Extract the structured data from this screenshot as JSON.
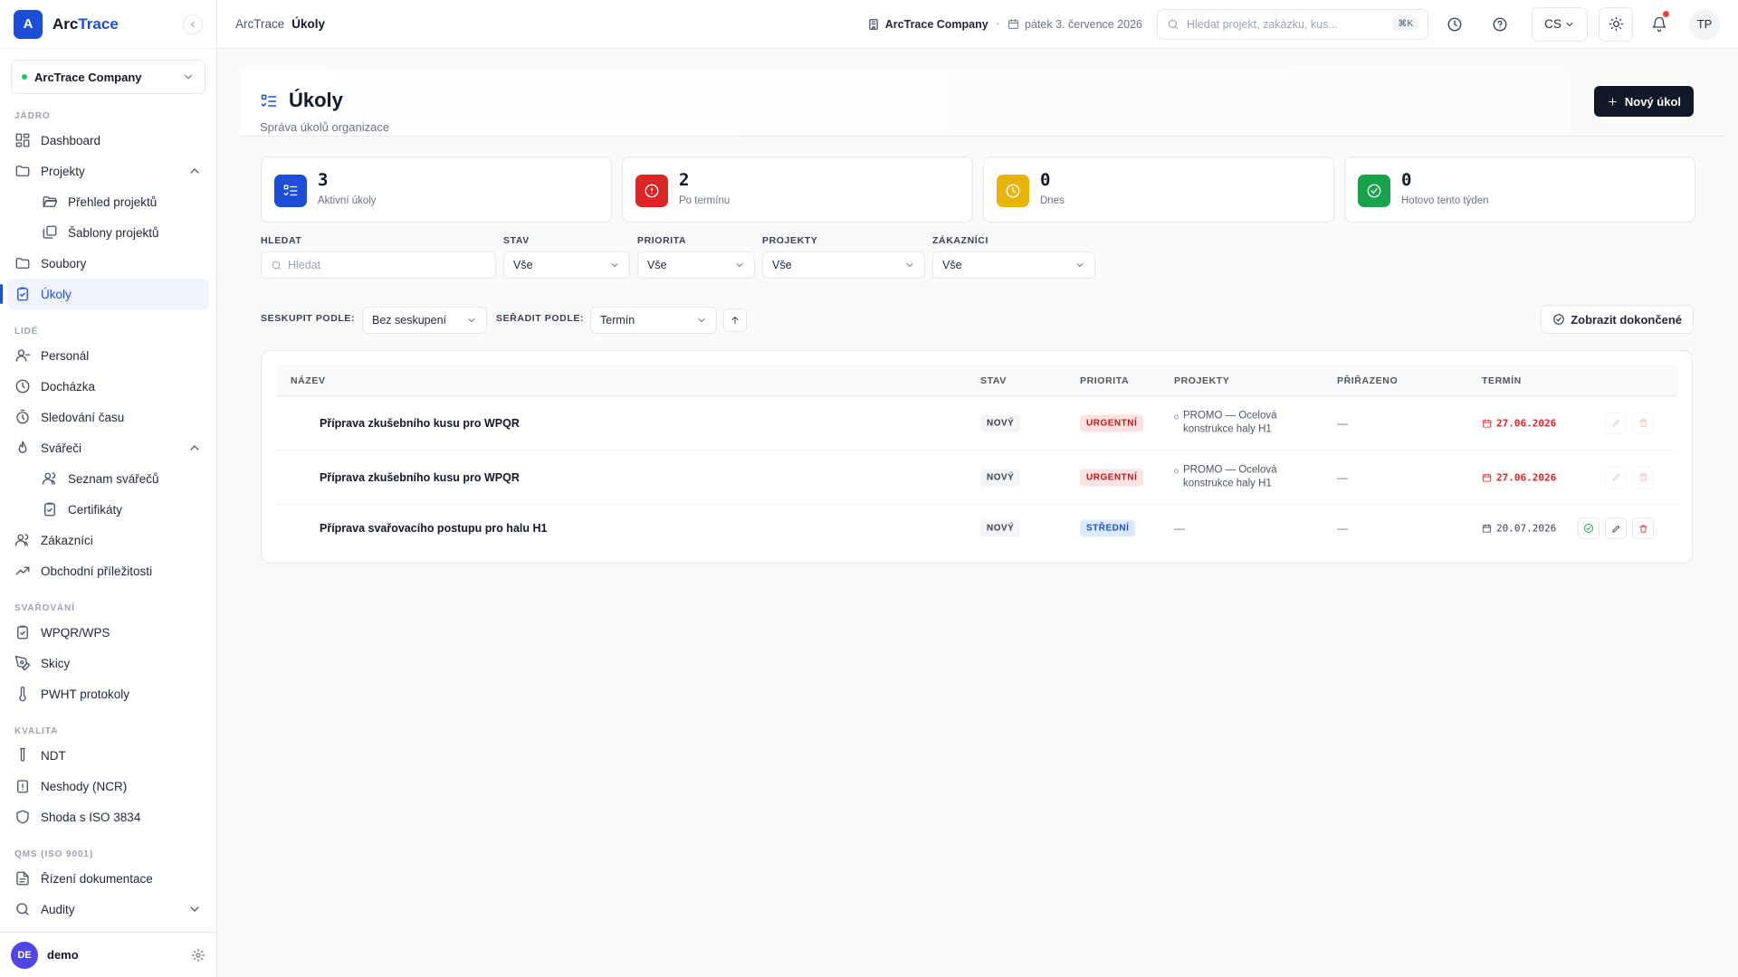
{
  "app": {
    "name_part1": "Arc",
    "name_part2": "Trace",
    "logo_letter": "A"
  },
  "sidebar": {
    "company": "ArcTrace Company",
    "sections": [
      {
        "title": "JÁDRO"
      },
      {
        "title": "LIDÉ"
      },
      {
        "title": "SVAŘOVÁNÍ"
      },
      {
        "title": "KVALITA"
      },
      {
        "title": "QMS (ISO 9001)"
      }
    ],
    "items": {
      "dashboard": "Dashboard",
      "projekty": "Projekty",
      "prehled": "Přehled projektů",
      "sablony": "Šablony projektů",
      "soubory": "Soubory",
      "ukoly": "Úkoly",
      "personal": "Personál",
      "dochazka": "Docházka",
      "sledovani": "Sledování času",
      "svareci": "Svářeči",
      "seznam": "Seznam svářečů",
      "certifikaty": "Certifikáty",
      "zakaznici": "Zákazníci",
      "obchodni": "Obchodní příležitosti",
      "wpqr": "WPQR/WPS",
      "skicy": "Skicy",
      "pwht": "PWHT protokoly",
      "ndt": "NDT",
      "neshody": "Neshody (NCR)",
      "shoda": "Shoda s ISO 3834",
      "rizeni": "Řízení dokumentace",
      "audity": "Audity"
    },
    "user": {
      "initials": "DE",
      "name": "demo"
    }
  },
  "topbar": {
    "breadcrumb_root": "ArcTrace",
    "breadcrumb_current": "Úkoly",
    "company": "ArcTrace Company",
    "date": "pátek 3. července 2026",
    "search_placeholder": "Hledat projekt, zakázku, kus...",
    "search_kbd": "⌘K",
    "language": "CS",
    "avatar": "TP"
  },
  "page": {
    "title": "Úkoly",
    "subtitle": "Správa úkolů organizace",
    "new_button": "Nový úkol"
  },
  "stats": [
    {
      "value": "3",
      "label": "Aktivní úkoly",
      "color": "#1d4ed8"
    },
    {
      "value": "2",
      "label": "Po termínu",
      "color": "#dc2626"
    },
    {
      "value": "0",
      "label": "Dnes",
      "color": "#eab308"
    },
    {
      "value": "0",
      "label": "Hotovo tento týden",
      "color": "#16a34a"
    }
  ],
  "filters": {
    "search_label": "HLEDAT",
    "search_placeholder": "Hledat",
    "stav_label": "STAV",
    "stav_value": "Vše",
    "priorita_label": "PRIORITA",
    "priorita_value": "Vše",
    "projekty_label": "PROJEKTY",
    "projekty_value": "Vše",
    "zakaznici_label": "ZÁKAZNÍCI",
    "zakaznici_value": "Vše"
  },
  "grouping": {
    "group_label": "SESKUPIT PODLE:",
    "group_value": "Bez seskupení",
    "sort_label": "SEŘADIT PODLE:",
    "sort_value": "Termín",
    "show_completed": "Zobrazit dokončené"
  },
  "table": {
    "headers": {
      "name": "NÁZEV",
      "status": "STAV",
      "priority": "PRIORITA",
      "projects": "PROJEKTY",
      "assigned": "PŘIŘAZENO",
      "due": "TERMÍN"
    },
    "rows": [
      {
        "name": "Příprava zkušebního kusu pro WPQR",
        "status": "NOVÝ",
        "priority": "URGENTNÍ",
        "project": "PROMO — Ocelová konstrukce haly H1",
        "assigned": "—",
        "due": "27.06.2026"
      },
      {
        "name": "Příprava zkušebního kusu pro WPQR",
        "status": "NOVÝ",
        "priority": "URGENTNÍ",
        "project": "PROMO — Ocelová konstrukce haly H1",
        "assigned": "—",
        "due": "27.06.2026"
      },
      {
        "name": "Příprava svařovacího postupu pro halu H1",
        "status": "NOVÝ",
        "priority": "STŘEDNÍ",
        "project": "—",
        "assigned": "—",
        "due": "20.07.2026"
      }
    ]
  }
}
